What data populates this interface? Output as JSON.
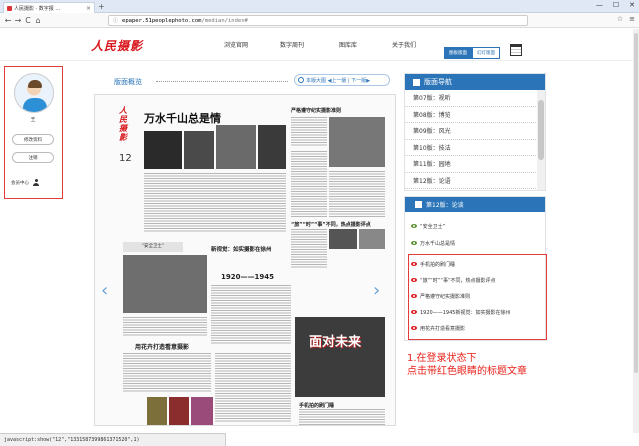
{
  "browser": {
    "tab_title": "人民摄影 · 数字报 ...",
    "tab_close": "×",
    "new_tab": "+",
    "url_host": "epaper.51peoplephoto.com",
    "url_path": "/median/index#",
    "nav_back": "←",
    "nav_forward": "→",
    "nav_reload": "C",
    "nav_home": "⌂",
    "right_icons": [
      "☆",
      "≡"
    ],
    "win_controls": [
      "—",
      "☐",
      "✕"
    ]
  },
  "header": {
    "logo": "人民摄影",
    "menu": [
      "浏览官网",
      "数字周刊",
      "图库库",
      "关于我们"
    ],
    "view_active": "图板版面",
    "view_inactive": "幻灯版面"
  },
  "user_panel": {
    "name": "王",
    "edit_profile": "修改资料",
    "logout": "注销",
    "member_center": "会员中心"
  },
  "paper": {
    "edition_label": "版面概览",
    "page_nav": "本版大图  ◀上一版 | 下一版▶",
    "logo": "人民摄影",
    "page_number": "12",
    "headline": "万水千山总是情",
    "side_headline": "严格遵守纪实摄影准则",
    "mid_headline": "“旅”“时”“事”不同，热点摄影评点",
    "section_box": "“安全卫士”",
    "section_headline": "新视觉：如实摄影在徐州",
    "year_headline": "1920——1945",
    "bottom_headline": "用花卉打造看意摄影",
    "side2_headline": "手机拍的刷门睡",
    "photo_text": "面对未来"
  },
  "nav_panel": {
    "title": "版面导航",
    "items": [
      "第07版：视听",
      "第08版：博览",
      "第09版：风光",
      "第10版：技法",
      "第11版：园地",
      "第12版：论语"
    ]
  },
  "article_panel": {
    "title": "第12版：论谈",
    "items": [
      {
        "label": "“安全卫士”",
        "eye": "green"
      },
      {
        "label": "万水千山总是情",
        "eye": "green"
      },
      {
        "label": "手机拍的刷门睡",
        "eye": "red"
      },
      {
        "label": "“旅”“时”“事”不同，热点摄影评点",
        "eye": "red"
      },
      {
        "label": "严格遵守纪实摄影准则",
        "eye": "red"
      },
      {
        "label": "1920——1945新视觉：如实摄影在徐州",
        "eye": "red"
      },
      {
        "label": "用花卉打造看意摄影",
        "eye": "red"
      }
    ]
  },
  "annotation": {
    "line1": "1.在登录状态下",
    "line2": "点击带红色眼睛的标题文章"
  },
  "status_bar": "javascript:show(\"12\",\"1331587399861371520\",1)"
}
